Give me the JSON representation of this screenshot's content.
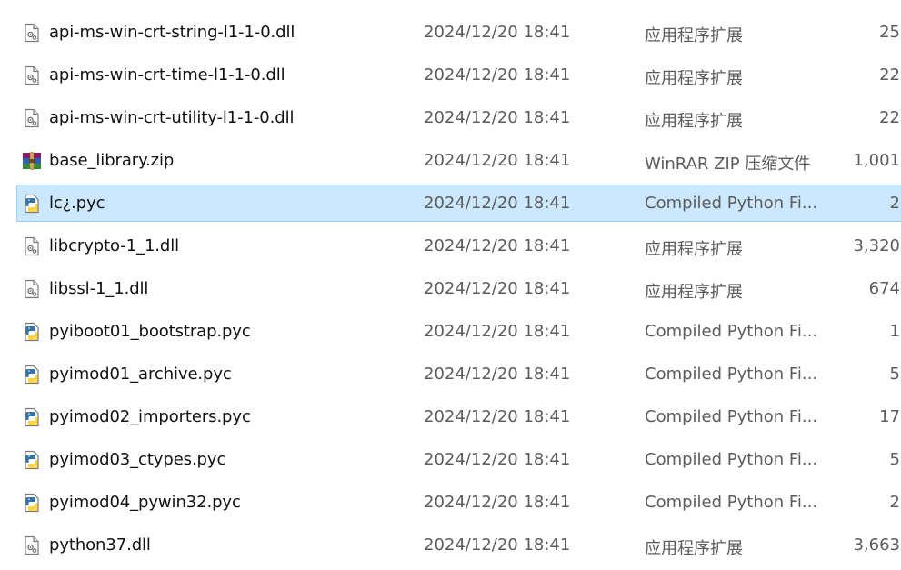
{
  "files": [
    {
      "name": "api-ms-win-crt-string-l1-1-0.dll",
      "date": "2024/12/20 18:41",
      "type": "应用程序扩展",
      "size": "25",
      "icon": "dll-file-icon",
      "selected": false
    },
    {
      "name": "api-ms-win-crt-time-l1-1-0.dll",
      "date": "2024/12/20 18:41",
      "type": "应用程序扩展",
      "size": "22",
      "icon": "dll-file-icon",
      "selected": false
    },
    {
      "name": "api-ms-win-crt-utility-l1-1-0.dll",
      "date": "2024/12/20 18:41",
      "type": "应用程序扩展",
      "size": "22",
      "icon": "dll-file-icon",
      "selected": false
    },
    {
      "name": "base_library.zip",
      "date": "2024/12/20 18:41",
      "type": "WinRAR ZIP 压缩文件",
      "size": "1,001",
      "icon": "winrar-archive-icon",
      "selected": false
    },
    {
      "name": "lc¿.pyc",
      "date": "2024/12/20 18:41",
      "type": "Compiled Python Fi...",
      "size": "2",
      "icon": "python-compiled-icon",
      "selected": true
    },
    {
      "name": "libcrypto-1_1.dll",
      "date": "2024/12/20 18:41",
      "type": "应用程序扩展",
      "size": "3,320",
      "icon": "dll-file-icon",
      "selected": false
    },
    {
      "name": "libssl-1_1.dll",
      "date": "2024/12/20 18:41",
      "type": "应用程序扩展",
      "size": "674",
      "icon": "dll-file-icon",
      "selected": false
    },
    {
      "name": "pyiboot01_bootstrap.pyc",
      "date": "2024/12/20 18:41",
      "type": "Compiled Python Fi...",
      "size": "1",
      "icon": "python-compiled-icon",
      "selected": false
    },
    {
      "name": "pyimod01_archive.pyc",
      "date": "2024/12/20 18:41",
      "type": "Compiled Python Fi...",
      "size": "5",
      "icon": "python-compiled-icon",
      "selected": false
    },
    {
      "name": "pyimod02_importers.pyc",
      "date": "2024/12/20 18:41",
      "type": "Compiled Python Fi...",
      "size": "17",
      "icon": "python-compiled-icon",
      "selected": false
    },
    {
      "name": "pyimod03_ctypes.pyc",
      "date": "2024/12/20 18:41",
      "type": "Compiled Python Fi...",
      "size": "5",
      "icon": "python-compiled-icon",
      "selected": false
    },
    {
      "name": "pyimod04_pywin32.pyc",
      "date": "2024/12/20 18:41",
      "type": "Compiled Python Fi...",
      "size": "2",
      "icon": "python-compiled-icon",
      "selected": false
    },
    {
      "name": "python37.dll",
      "date": "2024/12/20 18:41",
      "type": "应用程序扩展",
      "size": "3,663",
      "icon": "dll-file-icon",
      "selected": false
    }
  ],
  "colors": {
    "selection_bg": "#cce8ff",
    "selection_border": "#99d1ff",
    "name_text": "#111111",
    "meta_text": "#5c5c5c"
  }
}
